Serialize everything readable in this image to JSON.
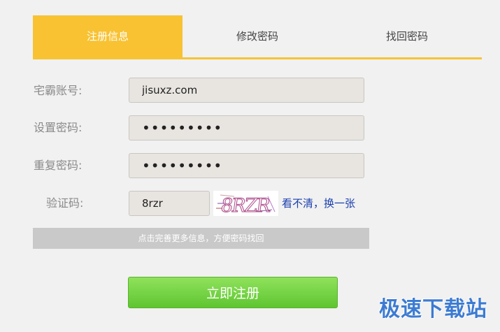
{
  "tabs": [
    {
      "label": "注册信息",
      "active": true
    },
    {
      "label": "修改密码",
      "active": false
    },
    {
      "label": "找回密码",
      "active": false
    }
  ],
  "form": {
    "account": {
      "label": "宅霸账号:",
      "value": "jisuxz.com"
    },
    "password": {
      "label": "设置密码:",
      "value": "•••••••••"
    },
    "confirm": {
      "label": "重复密码:",
      "value": "•••••••••"
    },
    "captcha": {
      "label": "验证码:",
      "value": "8rzr",
      "image_text": "8RZR",
      "refresh_label": "看不清，换一张"
    }
  },
  "hint": "点击完善更多信息，方便密码找回",
  "submit_label": "立即注册",
  "watermark": "极速下载站",
  "colors": {
    "accent": "#f8c232",
    "button": "#6fd03c",
    "link": "#1a3fae"
  }
}
